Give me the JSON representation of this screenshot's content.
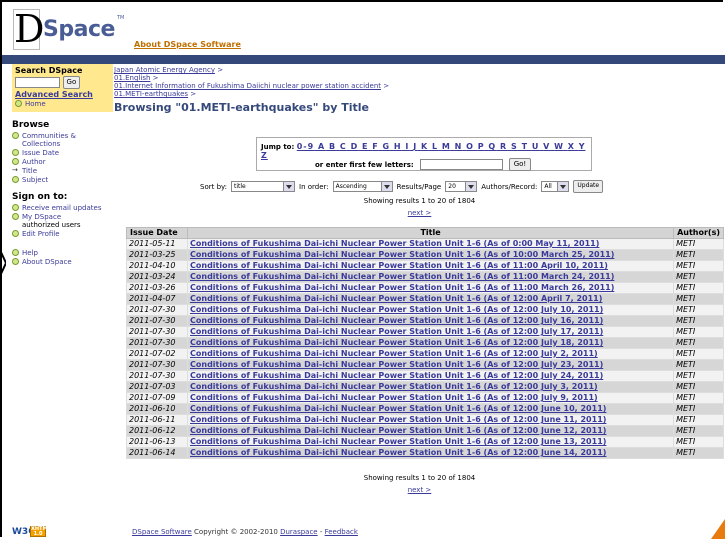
{
  "header": {
    "logo_letter": "D",
    "logo_text": "Space",
    "logo_tm": "TM",
    "about_link": "About DSpace Software"
  },
  "sidebar": {
    "search_title": "Search DSpace",
    "go_label": "Go",
    "advanced_search": "Advanced Search",
    "home": "Home",
    "browse_title": "Browse",
    "browse_items": [
      "Communities & Collections",
      "Issue Date",
      "Author",
      "Title",
      "Subject"
    ],
    "sign_on_title": "Sign on to:",
    "sign_items": [
      "Receive email updates",
      "My DSpace",
      "Edit Profile"
    ],
    "my_dspace_sub": "authorized users",
    "help": "Help",
    "about": "About DSpace"
  },
  "breadcrumbs": [
    "Japan Atomic Energy Agency",
    "01.English",
    "01.Internet Information of Fukushima Daiichi nuclear power station accident",
    "01.METI-earthquakes"
  ],
  "crumb_sep": ">",
  "page_title": "Browsing \"01.METI-earthquakes\" by Title",
  "jump": {
    "label": "Jump to:",
    "letters": [
      "0-9",
      "A",
      "B",
      "C",
      "D",
      "E",
      "F",
      "G",
      "H",
      "I",
      "J",
      "K",
      "L",
      "M",
      "N",
      "O",
      "P",
      "Q",
      "R",
      "S",
      "T",
      "U",
      "V",
      "W",
      "X",
      "Y",
      "Z"
    ],
    "first_letters_label": "or enter first few letters:",
    "go_label": "Go!"
  },
  "sort": {
    "sort_by_label": "Sort by:",
    "sort_by_value": "title",
    "order_label": "In order:",
    "order_value": "Ascending",
    "results_label": "Results/Page",
    "results_value": "20",
    "authors_label": "Authors/Record:",
    "authors_value": "All",
    "update_label": "Update"
  },
  "results_text": "Showing results 1 to 20 of 1804",
  "next_link": "next >",
  "table": {
    "headers": [
      "Issue Date",
      "Title",
      "Author(s)"
    ],
    "rows": [
      {
        "date": "2011-05-11",
        "title": "Conditions of Fukushima Dai-ichi Nuclear Power Station Unit 1-6 (As of 0:00 May 11, 2011)",
        "author": "METI"
      },
      {
        "date": "2011-03-25",
        "title": "Conditions of Fukushima Dai-ichi Nuclear Power Station Unit 1-6 (As of 10:00 March 25, 2011)",
        "author": "METI"
      },
      {
        "date": "2011-04-10",
        "title": "Conditions of Fukushima Dai-ichi Nuclear Power Station Unit 1-6 (As of 11:00 April 10, 2011)",
        "author": "METI"
      },
      {
        "date": "2011-03-24",
        "title": "Conditions of Fukushima Dai-ichi Nuclear Power Station Unit 1-6 (As of 11:00 March 24, 2011)",
        "author": "METI"
      },
      {
        "date": "2011-03-26",
        "title": "Conditions of Fukushima Dai-ichi Nuclear Power Station Unit 1-6 (As of 11:00 March 26, 2011)",
        "author": "METI"
      },
      {
        "date": "2011-04-07",
        "title": "Conditions of Fukushima Dai-ichi Nuclear Power Station Unit 1-6 (As of 12:00 April 7, 2011)",
        "author": "METI"
      },
      {
        "date": "2011-07-30",
        "title": "Conditions of Fukushima Dai-ichi Nuclear Power Station Unit 1-6 (As of 12:00 July 10, 2011)",
        "author": "METI"
      },
      {
        "date": "2011-07-30",
        "title": "Conditions of Fukushima Dai-ichi Nuclear Power Station Unit 1-6 (As of 12:00 July 16, 2011)",
        "author": "METI"
      },
      {
        "date": "2011-07-30",
        "title": "Conditions of Fukushima Dai-ichi Nuclear Power Station Unit 1-6 (As of 12:00 July 17, 2011)",
        "author": "METI"
      },
      {
        "date": "2011-07-30",
        "title": "Conditions of Fukushima Dai-ichi Nuclear Power Station Unit 1-6 (As of 12:00 July 18, 2011)",
        "author": "METI"
      },
      {
        "date": "2011-07-02",
        "title": "Conditions of Fukushima Dai-ichi Nuclear Power Station Unit 1-6 (As of 12:00 July 2, 2011)",
        "author": "METI"
      },
      {
        "date": "2011-07-30",
        "title": "Conditions of Fukushima Dai-ichi Nuclear Power Station Unit 1-6 (As of 12:00 July 23, 2011)",
        "author": "METI"
      },
      {
        "date": "2011-07-30",
        "title": "Conditions of Fukushima Dai-ichi Nuclear Power Station Unit 1-6 (As of 12:00 July 24, 2011)",
        "author": "METI"
      },
      {
        "date": "2011-07-03",
        "title": "Conditions of Fukushima Dai-ichi Nuclear Power Station Unit 1-6 (As of 12:00 July 3, 2011)",
        "author": "METI"
      },
      {
        "date": "2011-07-09",
        "title": "Conditions of Fukushima Dai-ichi Nuclear Power Station Unit 1-6 (As of 12:00 July 9, 2011)",
        "author": "METI"
      },
      {
        "date": "2011-06-10",
        "title": "Conditions of Fukushima Dai-ichi Nuclear Power Station Unit 1-6 (As of 12:00 June 10, 2011)",
        "author": "METI"
      },
      {
        "date": "2011-06-11",
        "title": "Conditions of Fukushima Dai-ichi Nuclear Power Station Unit 1-6 (As of 12:00 June 11, 2011)",
        "author": "METI"
      },
      {
        "date": "2011-06-12",
        "title": "Conditions of Fukushima Dai-ichi Nuclear Power Station Unit 1-6 (As of 12:00 June 12, 2011)",
        "author": "METI"
      },
      {
        "date": "2011-06-13",
        "title": "Conditions of Fukushima Dai-ichi Nuclear Power Station Unit 1-6 (As of 12:00 June 13, 2011)",
        "author": "METI"
      },
      {
        "date": "2011-06-14",
        "title": "Conditions of Fukushima Dai-ichi Nuclear Power Station Unit 1-6 (As of 12:00 June 14, 2011)",
        "author": "METI"
      }
    ]
  },
  "footer": {
    "text1": "DSpace Software",
    "text2": " Copyright © 2002-2010 ",
    "text3": "Duraspace",
    "text4": " - ",
    "text5": "Feedback"
  },
  "w3c": {
    "w3c": "W3C",
    "xhtml": "XHTML",
    "version": "1.0"
  },
  "colors": {
    "accent": "#35487a",
    "search_bg": "#ffe88e",
    "link": "#3a3a9a",
    "about_link": "#c07000"
  }
}
